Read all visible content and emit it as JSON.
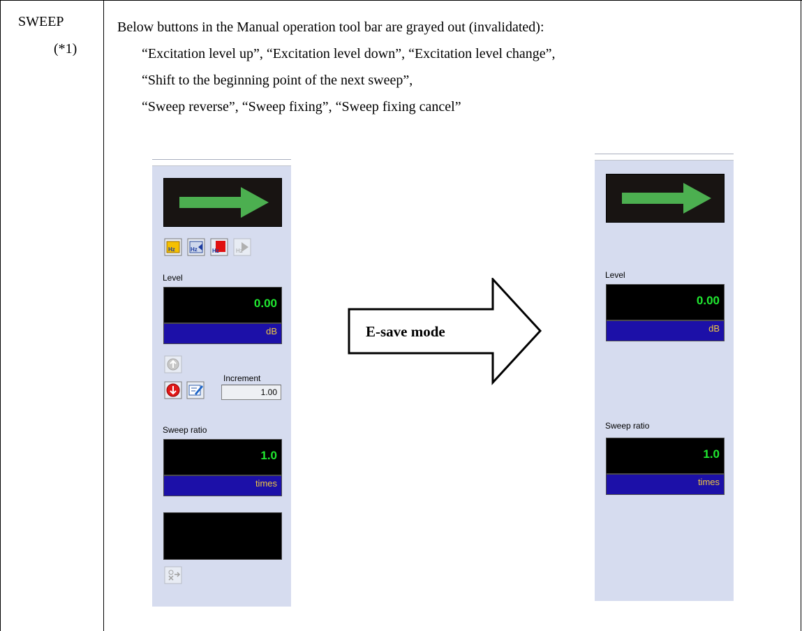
{
  "row": {
    "label": "SWEEP",
    "ref": "(*1)"
  },
  "description": {
    "line1": "Below buttons in the Manual operation tool bar are grayed out (invalidated):",
    "line2": "“Excitation level up”, “Excitation level down”, “Excitation level change”,",
    "line3": "“Shift to the beginning point of the next sweep”,",
    "line4": "“Sweep reverse”, “Sweep fixing”, “Sweep fixing cancel”"
  },
  "transition": {
    "label": "E-save mode"
  },
  "left_panel": {
    "level_label": "Level",
    "level_value": "0.00",
    "level_unit": "dB",
    "increment_label": "Increment",
    "increment_value": "1.00",
    "sweep_ratio_label": "Sweep ratio",
    "sweep_ratio_value": "1.0",
    "sweep_ratio_unit": "times",
    "icons": [
      "sweep-fixing-icon",
      "sweep-reverse-icon",
      "shift-next-sweep-icon",
      "sweep-fixing-cancel-icon",
      "level-up-icon",
      "level-down-icon",
      "level-change-icon",
      "settings-icon"
    ]
  },
  "right_panel": {
    "level_label": "Level",
    "level_value": "0.00",
    "level_unit": "dB",
    "sweep_ratio_label": "Sweep ratio",
    "sweep_ratio_value": "1.0",
    "sweep_ratio_unit": "times"
  },
  "colors": {
    "panel_bg": "#d6dcef",
    "display_bg": "#000000",
    "value_green": "#20e830",
    "unit_bg": "#1c10a8",
    "unit_text": "#f0c840",
    "arrow_green": "#4caf50"
  }
}
